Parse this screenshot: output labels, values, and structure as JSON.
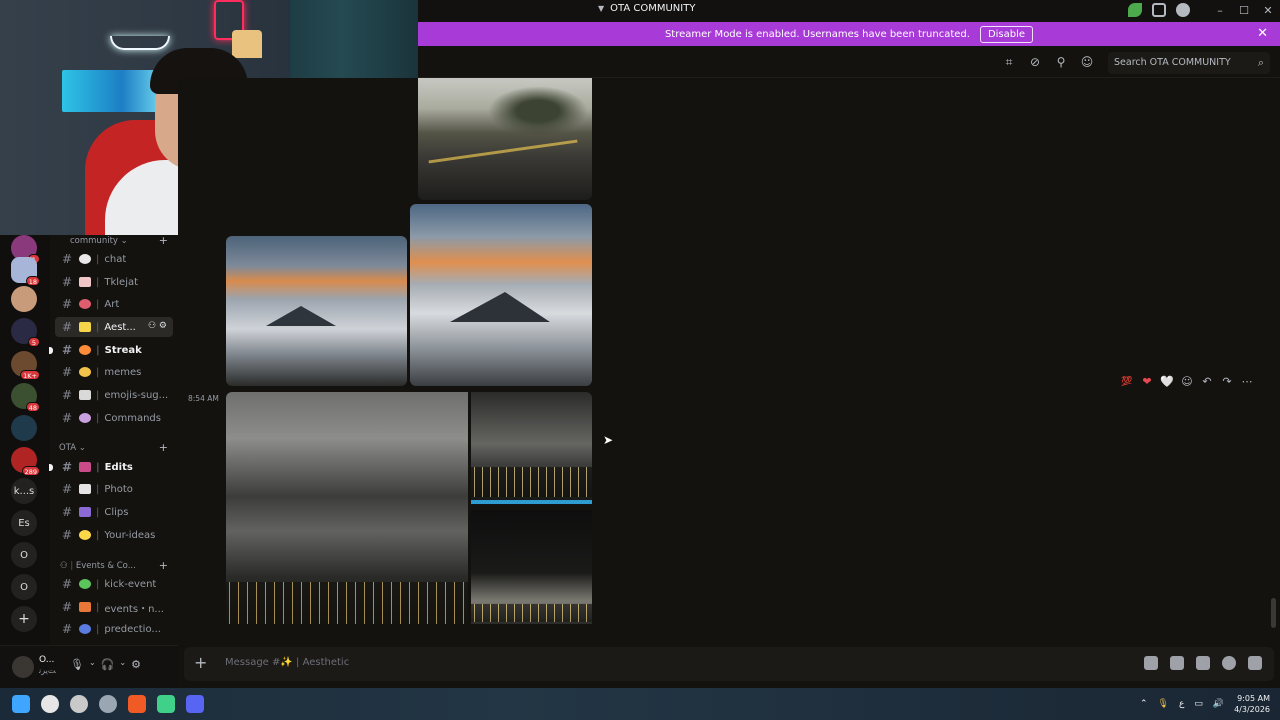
{
  "window": {
    "title": "OTA COMMUNITY",
    "controls": [
      "minimize",
      "maximize",
      "close"
    ]
  },
  "banner": {
    "text": "Streamer Mode is enabled. Usernames have been truncated.",
    "button": "Disable",
    "bg": "#a83ad8"
  },
  "header": {
    "search_placeholder": "Search OTA COMMUNITY",
    "icons": [
      "threads-icon",
      "mute-notifications-icon",
      "pinned-icon",
      "member-list-icon"
    ]
  },
  "servers": [
    {
      "badge": "1",
      "color": "#8a3a7c"
    },
    {
      "badge": "18",
      "color": "#a7b6d8"
    },
    {
      "badge": "",
      "color": "#c89b7a"
    },
    {
      "badge": "5",
      "color": "#2b2a44"
    },
    {
      "badge": "1K+",
      "color": "#6b4a2f"
    },
    {
      "badge": "48",
      "color": "#3a5030"
    },
    {
      "badge": "",
      "color": "#1f3a4a"
    },
    {
      "badge": "289",
      "color": "#b02424"
    },
    {
      "text": "k...s"
    },
    {
      "text": "Es"
    },
    {
      "text": "O"
    },
    {
      "text": "O"
    },
    {
      "text": "+"
    }
  ],
  "categories": [
    {
      "name": "community"
    },
    {
      "name": "OTA"
    },
    {
      "name": "Events & Co..."
    }
  ],
  "channels": {
    "community": [
      {
        "label": "chat",
        "emoji_color": "#e9e9e9"
      },
      {
        "label": "Tklejat",
        "emoji_color": "#f1c6c6"
      },
      {
        "label": "Art",
        "emoji_color": "#e05d6f"
      },
      {
        "label": "Aest...",
        "emoji_color": "#f7d54b"
      },
      {
        "label": "Streak",
        "emoji_color": "#ff8c3a"
      },
      {
        "label": "memes",
        "emoji_color": "#f2c24b"
      },
      {
        "label": "emojis-sug...",
        "emoji_color": "#d9d9d9"
      },
      {
        "label": "Commands",
        "emoji_color": "#c9a0e0"
      }
    ],
    "ota": [
      {
        "label": "Edits",
        "emoji_color": "#c94b8a"
      },
      {
        "label": "Photo",
        "emoji_color": "#e4e4e4"
      },
      {
        "label": "Clips",
        "emoji_color": "#8a6bd6"
      },
      {
        "label": "Your-ideas",
        "emoji_color": "#ffd84a"
      }
    ],
    "events": [
      {
        "label": "kick-event",
        "emoji_color": "#5cc45c"
      },
      {
        "label": "events・n...",
        "emoji_color": "#e8783a"
      },
      {
        "label": "predectio...",
        "emoji_color": "#5a7be0"
      }
    ]
  },
  "user": {
    "name": "O...",
    "status": "ﺖﯾﺮﻧ"
  },
  "message": {
    "timestamp": "8:54 AM",
    "reactions": [
      "💯",
      "❤",
      "🤍"
    ]
  },
  "composer": {
    "placeholder": "Message #✨ | Aesthetic",
    "icons": [
      "gift-icon",
      "gif-icon",
      "sticker-icon",
      "emoji-icon",
      "apps-icon"
    ]
  },
  "taskbar": {
    "time": "9:05 AM",
    "date": "4/3/2026",
    "lang": "ع"
  }
}
